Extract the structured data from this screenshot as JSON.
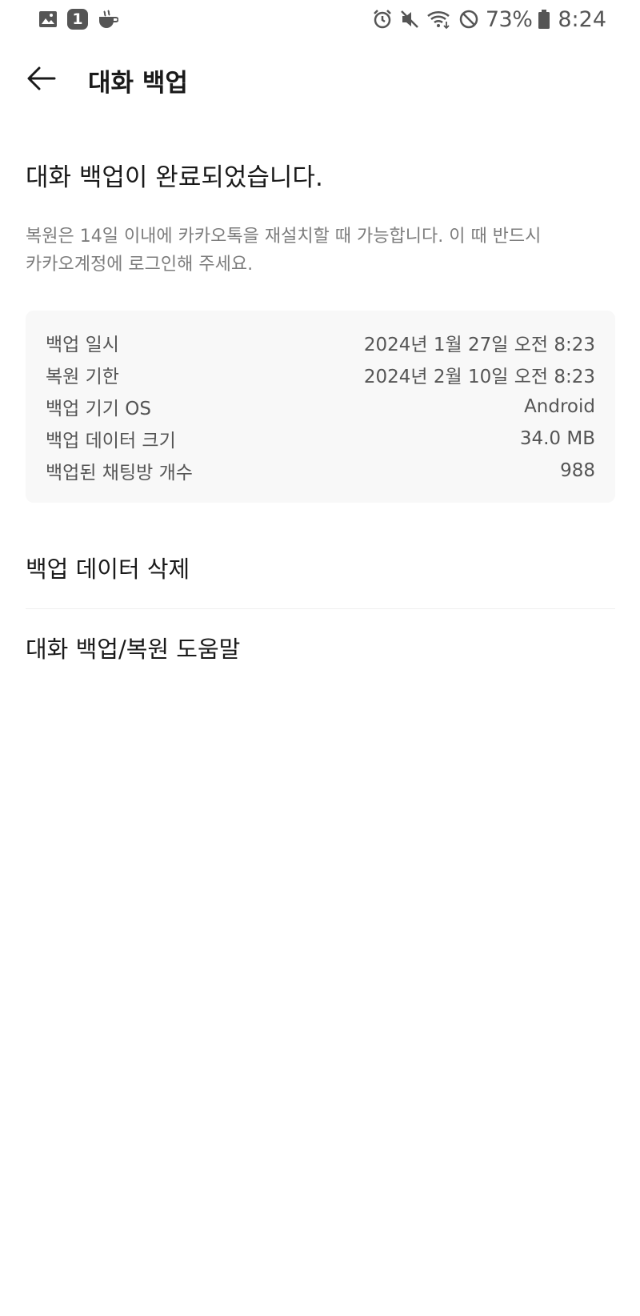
{
  "status_bar": {
    "left_icons": [
      "gallery-icon",
      "notification-count-icon",
      "coffee-icon"
    ],
    "notification_count": "1",
    "right_icons": [
      "alarm-icon",
      "mute-icon",
      "wifi-icon",
      "do-not-disturb-icon",
      "battery-icon"
    ],
    "battery_percent": "73%",
    "time": "8:24"
  },
  "app_bar": {
    "back_icon": "back-arrow-icon",
    "title": "대화 백업"
  },
  "headline": "대화 백업이 완료되었습니다.",
  "description_line1": "복원은 14일 이내에 카카오톡을 재설치할 때 가능합니다. 이 때 반드시",
  "description_line2": "카카오계정에 로그인해 주세요.",
  "info": [
    {
      "label": "백업 일시",
      "value": "2024년 1월 27일 오전 8:23"
    },
    {
      "label": "복원 기한",
      "value": "2024년 2월 10일 오전 8:23"
    },
    {
      "label": "백업 기기 OS",
      "value": "Android"
    },
    {
      "label": "백업 데이터 크기",
      "value": "34.0 MB"
    },
    {
      "label": "백업된 채팅방 개수",
      "value": "988"
    }
  ],
  "menu": {
    "delete_label": "백업 데이터 삭제",
    "help_label": "대화 백업/복원 도움말"
  },
  "colors": {
    "background": "#ffffff",
    "text_primary": "#1a1a1a",
    "text_secondary": "#7c7c7c",
    "card_background": "#f8f8f8",
    "status_icons": "#555555"
  }
}
